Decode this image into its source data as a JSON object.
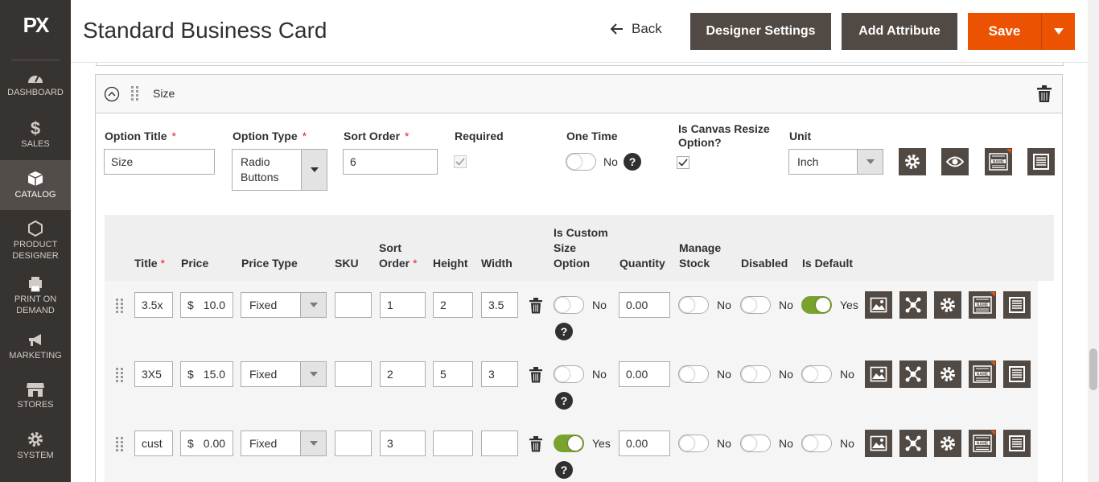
{
  "brand": {
    "logo": "PX"
  },
  "sidebar": {
    "items": [
      {
        "label": "DASHBOARD",
        "icon": "dashboard-icon"
      },
      {
        "label": "SALES",
        "icon": "dollar-icon"
      },
      {
        "label": "CATALOG",
        "icon": "box-icon"
      },
      {
        "label": "PRODUCT DESIGNER",
        "icon": "hexagon-icon"
      },
      {
        "label": "PRINT ON DEMAND",
        "icon": "printer-icon"
      },
      {
        "label": "MARKETING",
        "icon": "megaphone-icon"
      },
      {
        "label": "STORES",
        "icon": "store-icon"
      },
      {
        "label": "SYSTEM",
        "icon": "gear-icon"
      }
    ],
    "active": "CATALOG"
  },
  "header": {
    "title": "Standard Business Card",
    "back_label": "Back",
    "designer_settings_label": "Designer Settings",
    "add_attribute_label": "Add Attribute",
    "save_label": "Save"
  },
  "option": {
    "panel_title": "Size",
    "option_title_label": "Option Title",
    "option_title_value": "Size",
    "option_type_label": "Option Type",
    "option_type_value": "Radio Buttons",
    "sort_order_label": "Sort Order",
    "sort_order_value": "6",
    "required_label": "Required",
    "one_time_label": "One Time",
    "one_time_value": "No",
    "canvas_resize_label": "Is Canvas Resize Option?",
    "unit_label": "Unit",
    "unit_value": "Inch",
    "required_checked": true,
    "canvas_resize_checked": true,
    "one_time_on": false
  },
  "grid": {
    "headers": {
      "title": "Title",
      "price": "Price",
      "price_type": "Price Type",
      "sku": "SKU",
      "sort_order": "Sort Order",
      "height": "Height",
      "width": "Width",
      "custom_size": "Is Custom Size Option",
      "quantity": "Quantity",
      "manage_stock": "Manage Stock",
      "disabled": "Disabled",
      "is_default": "Is Default"
    },
    "currency": "$",
    "rows": [
      {
        "title": "3.5x",
        "price": "10.0",
        "price_type": "Fixed",
        "sku": "",
        "sort_order": "1",
        "height": "2",
        "width": "3.5",
        "custom_size": "No",
        "custom_size_on": false,
        "quantity": "0.00",
        "manage_stock": "No",
        "disabled": "No",
        "is_default": "Yes",
        "is_default_on": true
      },
      {
        "title": "3X5",
        "price": "15.0",
        "price_type": "Fixed",
        "sku": "",
        "sort_order": "2",
        "height": "5",
        "width": "3",
        "custom_size": "No",
        "custom_size_on": false,
        "quantity": "0.00",
        "manage_stock": "No",
        "disabled": "No",
        "is_default": "No",
        "is_default_on": false
      },
      {
        "title": "cust",
        "price": "0.00",
        "price_type": "Fixed",
        "sku": "",
        "sort_order": "3",
        "height": "",
        "width": "",
        "custom_size": "Yes",
        "custom_size_on": true,
        "quantity": "0.00",
        "manage_stock": "No",
        "disabled": "No",
        "is_default": "No",
        "is_default_on": false
      }
    ]
  },
  "colors": {
    "accent": "#eb5202",
    "dark_button": "#514943",
    "sidebar": "#373330",
    "toggle_on": "#79a22e"
  }
}
